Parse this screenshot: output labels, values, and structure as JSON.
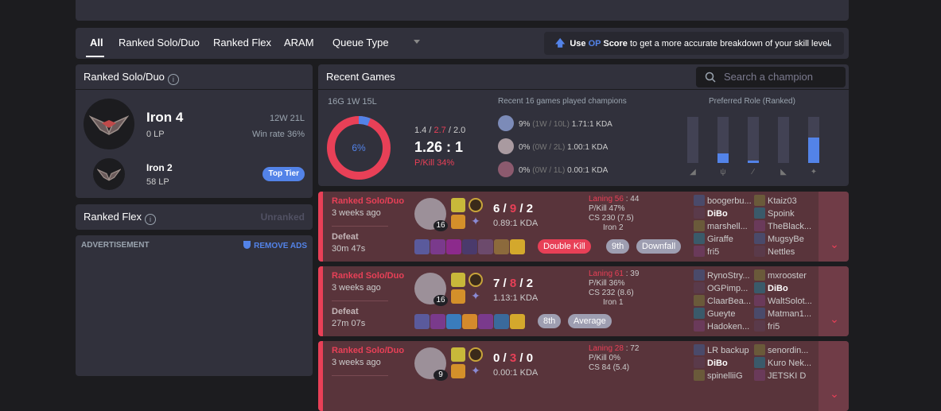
{
  "tabs": [
    {
      "label": "All"
    },
    {
      "label": "Ranked Solo/Duo"
    },
    {
      "label": "Ranked Flex"
    },
    {
      "label": "ARAM"
    },
    {
      "label": "Queue Type"
    }
  ],
  "op_banner": {
    "pre": "Use ",
    "op": "OP",
    "score": " Score",
    "post": " to get a more accurate breakdown of your skill level."
  },
  "solo": {
    "title": "Ranked Solo/Duo",
    "tier": "Iron 4",
    "lp": "0 LP",
    "record": "12W 21L",
    "winrate": "Win rate 36%",
    "peak_tier": "Iron 2",
    "peak_lp": "58 LP",
    "badge": "Top Tier"
  },
  "flex": {
    "title": "Ranked Flex",
    "status": "Unranked"
  },
  "ad": {
    "label": "ADVERTISEMENT",
    "remove": "REMOVE ADS"
  },
  "recent": {
    "title": "Recent Games",
    "search_placeholder": "Search a champion",
    "summary": "16G 1W 15L",
    "winrate_label": "6%",
    "winrate_value": 6,
    "k": "1.4",
    "d": "2.7",
    "a": "2.0",
    "sep1": " / ",
    "sep2": " / ",
    "kda_ratio": "1.26 : 1",
    "pkill": "P/Kill 34%",
    "champs_title": "Recent 16 games played champions",
    "champs": [
      {
        "wr": "9%",
        "rec": "(1W / 10L)",
        "kda": "1.71:1 KDA"
      },
      {
        "wr": "0%",
        "rec": "(0W / 2L)",
        "kda": "1.00:1 KDA"
      },
      {
        "wr": "0%",
        "rec": "(0W / 1L)",
        "kda": "0.00:1 KDA"
      }
    ],
    "role_title": "Preferred Role (Ranked)",
    "roles": [
      {
        "name": "top-icon",
        "value": 0
      },
      {
        "name": "jungle-icon",
        "value": 0.2
      },
      {
        "name": "mid-icon",
        "value": 0.05
      },
      {
        "name": "bottom-icon",
        "value": 0
      },
      {
        "name": "support-icon",
        "value": 0.55
      }
    ]
  },
  "games": [
    {
      "type": "Ranked Solo/Duo",
      "ago": "3 weeks ago",
      "result": "Defeat",
      "duration": "30m 47s",
      "level": "16",
      "k": "6",
      "d": "9",
      "a": "2",
      "kda": "0.89:1 KDA",
      "badges": [
        "Double Kill",
        "9th",
        "Downfall"
      ],
      "laning_a": "Laning 56",
      "laning_b": " : 44",
      "pkill": "P/Kill 47%",
      "cs": "CS 230 (7.5)",
      "rank": "Iron 2",
      "team1": [
        "boogerbu...",
        "DiBo",
        "marshell...",
        "Giraffe",
        "fri5"
      ],
      "team2": [
        "Ktaiz03",
        "Spoink",
        "TheBlack...",
        "MugsyBe",
        "Nettles"
      ]
    },
    {
      "type": "Ranked Solo/Duo",
      "ago": "3 weeks ago",
      "result": "Defeat",
      "duration": "27m 07s",
      "level": "16",
      "k": "7",
      "d": "8",
      "a": "2",
      "kda": "1.13:1 KDA",
      "badges": [
        "8th",
        "Average"
      ],
      "laning_a": "Laning 61",
      "laning_b": " : 39",
      "pkill": "P/Kill 36%",
      "cs": "CS 232 (8.6)",
      "rank": "Iron 1",
      "team1": [
        "RynoStry...",
        "OGPimp...",
        "ClaarBea...",
        "Gueyte",
        "Hadoken..."
      ],
      "team2": [
        "mxrooster",
        "DiBo",
        "WaltSolot...",
        "Matman1...",
        "fri5"
      ]
    },
    {
      "type": "Ranked Solo/Duo",
      "ago": "3 weeks ago",
      "result": "",
      "duration": "",
      "level": "9",
      "k": "0",
      "d": "3",
      "a": "0",
      "kda": "0.00:1 KDA",
      "badges": [],
      "laning_a": "Laning 28",
      "laning_b": " : 72",
      "pkill": "P/Kill 0%",
      "cs": "CS 84 (5.4)",
      "rank": "",
      "team1": [
        "LR backup",
        "DiBo",
        "spinelliiG"
      ],
      "team2": [
        "senordin...",
        "Kuro Nek...",
        "JETSKI D"
      ]
    }
  ]
}
